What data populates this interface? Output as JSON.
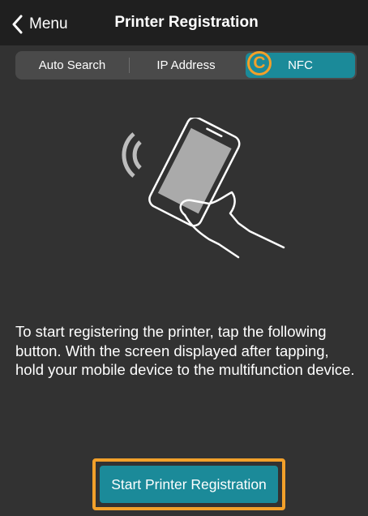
{
  "nav": {
    "back_label": "Menu",
    "title": "Printer Registration"
  },
  "tabs": [
    {
      "label": "Auto Search",
      "selected": false
    },
    {
      "label": "IP Address",
      "selected": false
    },
    {
      "label": "NFC",
      "selected": true
    }
  ],
  "callout": {
    "letter": "C"
  },
  "illustration": {
    "icons": [
      "nfc-waves-icon",
      "phone-in-hand-icon"
    ]
  },
  "instructions": "To start registering the printer, tap the following button. With the screen displayed after tapping, hold your mobile device to the multifunction device.",
  "button": {
    "label": "Start Printer Registration"
  },
  "colors": {
    "accent": "#1b8a99",
    "highlight": "#f2a02a",
    "background": "#323232",
    "navbar": "#1f1f1f"
  }
}
